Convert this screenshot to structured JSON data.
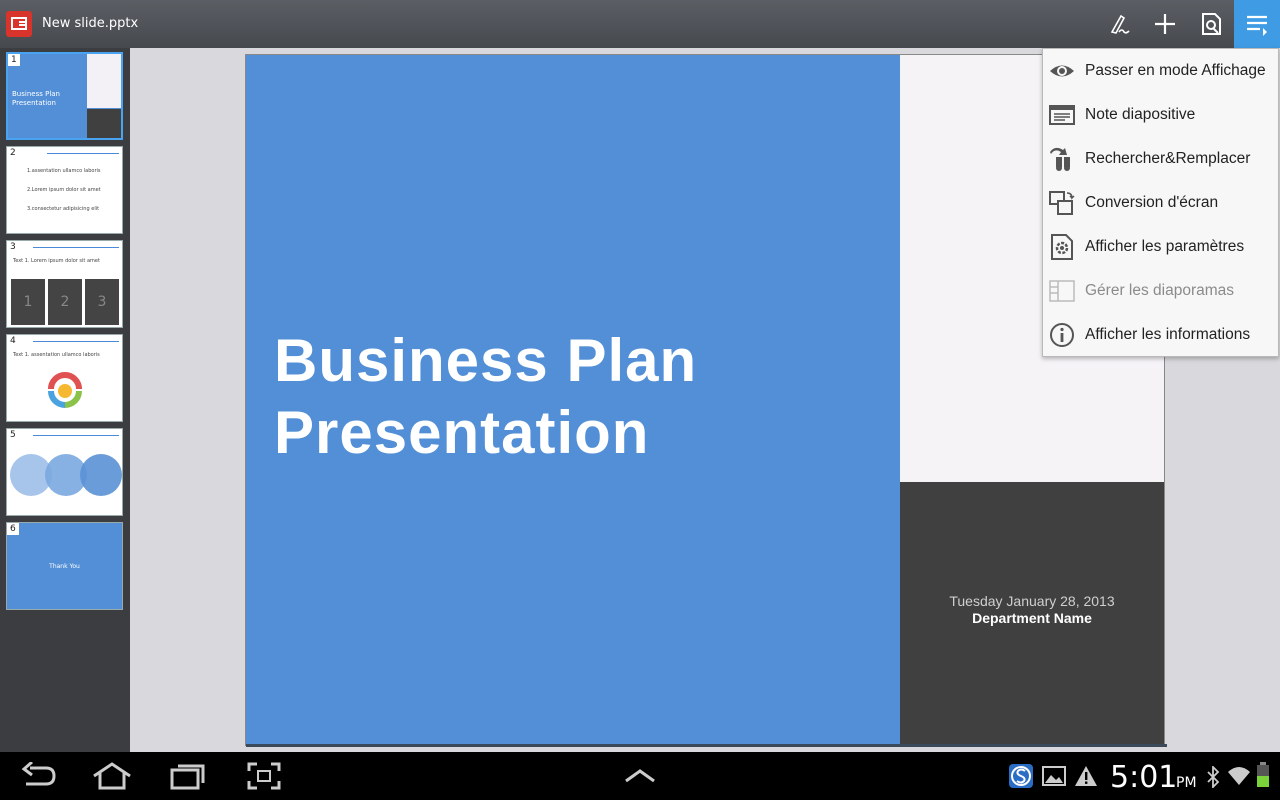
{
  "app": {
    "file_name": "New slide.pptx"
  },
  "toolbar": {
    "buttons": [
      "pen-icon",
      "add-icon",
      "save-icon",
      "menu-icon"
    ],
    "accent": "#3f9be3"
  },
  "thumbnails": [
    {
      "number": "1",
      "title": "Business Plan Presentation"
    },
    {
      "number": "2",
      "lines": [
        "1.assentation ullamco laboris",
        "2.Lorem ipsum dolor sit amet",
        "3.consectetur adipisicing elit"
      ]
    },
    {
      "number": "3",
      "title": "Text 1. Lorem ipsum dolor sit amet",
      "cards": [
        "1",
        "2",
        "3"
      ]
    },
    {
      "number": "4",
      "title": "Text 1. assentation ullamco laboris"
    },
    {
      "number": "5"
    },
    {
      "number": "6",
      "title": "Thank You"
    }
  ],
  "slide": {
    "title_line1": "Business Plan",
    "title_line2": "Presentation",
    "date": "Tuesday January 28, 2013",
    "department": "Department Name",
    "colors": {
      "blue": "#528fd7",
      "dark": "#404040"
    }
  },
  "menu": {
    "items": [
      {
        "label": "Passer en mode Affichage",
        "icon": "eye-icon",
        "enabled": true
      },
      {
        "label": "Note diapositive",
        "icon": "note-icon",
        "enabled": true
      },
      {
        "label": "Rechercher&Remplacer",
        "icon": "search-replace-icon",
        "enabled": true
      },
      {
        "label": "Conversion d'écran",
        "icon": "screen-convert-icon",
        "enabled": true
      },
      {
        "label": "Afficher les paramètres",
        "icon": "settings-icon",
        "enabled": true
      },
      {
        "label": "Gérer les diaporamas",
        "icon": "slideshow-manage-icon",
        "enabled": false
      },
      {
        "label": "Afficher les informations",
        "icon": "info-icon",
        "enabled": true
      }
    ]
  },
  "status": {
    "time": "5:01",
    "ampm": "PM"
  }
}
